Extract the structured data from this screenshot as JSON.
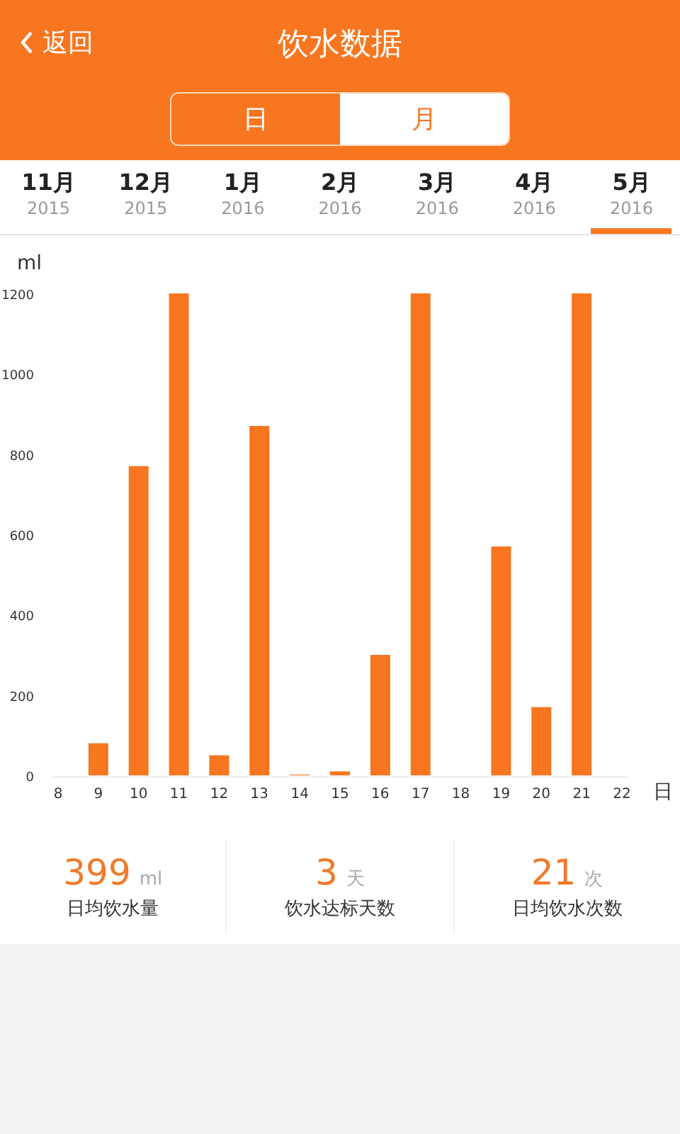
{
  "header": {
    "back": "返回",
    "title": "饮水数据"
  },
  "segments": [
    {
      "label": "日",
      "selected": false
    },
    {
      "label": "月",
      "selected": true
    }
  ],
  "months": [
    {
      "month": "11月",
      "year": "2015",
      "selected": false
    },
    {
      "month": "12月",
      "year": "2015",
      "selected": false
    },
    {
      "month": "1月",
      "year": "2016",
      "selected": false
    },
    {
      "month": "2月",
      "year": "2016",
      "selected": false
    },
    {
      "month": "3月",
      "year": "2016",
      "selected": false
    },
    {
      "month": "4月",
      "year": "2016",
      "selected": false
    },
    {
      "month": "5月",
      "year": "2016",
      "selected": true
    }
  ],
  "chart": {
    "chart_data": {
      "type": "bar",
      "ylabel": "ml",
      "xlabel": "日",
      "categories": [
        "8",
        "9",
        "10",
        "11",
        "12",
        "13",
        "14",
        "15",
        "16",
        "17",
        "18",
        "19",
        "20",
        "21",
        "22"
      ],
      "series": [
        {
          "color": "#f7761f",
          "values": [
            0,
            80,
            770,
            1200,
            50,
            870,
            2,
            10,
            300,
            1200,
            0,
            570,
            170,
            1200,
            0
          ]
        }
      ],
      "ylim": [
        0,
        1200
      ],
      "yticks": [
        0,
        200,
        400,
        600,
        800,
        1000,
        1200
      ]
    }
  },
  "stats": [
    {
      "value": "399",
      "unit": "ml",
      "label": "日均饮水量"
    },
    {
      "value": "3",
      "unit": "天",
      "label": "饮水达标天数"
    },
    {
      "value": "21",
      "unit": "次",
      "label": "日均饮水次数"
    }
  ]
}
